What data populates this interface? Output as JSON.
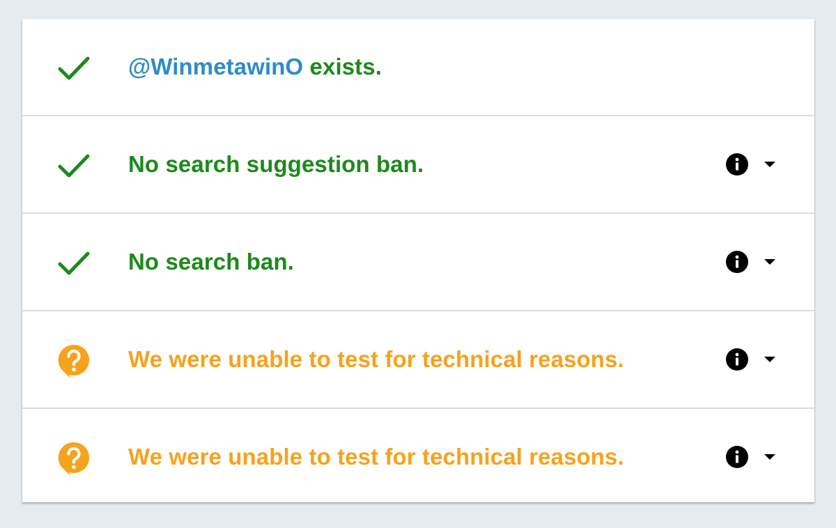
{
  "colors": {
    "success": "#1b8a1b",
    "warning": "#f7a21b",
    "handle": "#2e8cc9",
    "icon": "#000000"
  },
  "results": [
    {
      "status": "ok",
      "icon": "checkmark-icon",
      "handle": "@WinmetawinO",
      "text": " exists.",
      "has_details": false
    },
    {
      "status": "ok",
      "icon": "checkmark-icon",
      "text": "No search suggestion ban.",
      "has_details": true,
      "details_icon": "info-icon",
      "expand_icon": "dropdown-arrow-icon"
    },
    {
      "status": "ok",
      "icon": "checkmark-icon",
      "text": "No search ban.",
      "has_details": true,
      "details_icon": "info-icon",
      "expand_icon": "dropdown-arrow-icon"
    },
    {
      "status": "unknown",
      "icon": "question-bubble-icon",
      "text": "We were unable to test for technical reasons.",
      "has_details": true,
      "details_icon": "info-icon",
      "expand_icon": "dropdown-arrow-icon"
    },
    {
      "status": "unknown",
      "icon": "question-bubble-icon",
      "text": "We were unable to test for technical reasons.",
      "has_details": true,
      "details_icon": "info-icon",
      "expand_icon": "dropdown-arrow-icon"
    }
  ]
}
